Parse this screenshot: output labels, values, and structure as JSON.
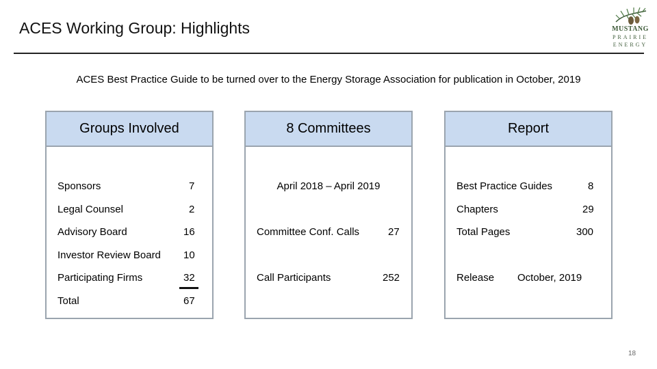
{
  "header": {
    "title": "ACES Working Group: Highlights",
    "logo": {
      "line1": "MUSTANG",
      "line2": "PRAIRIE",
      "line3": "ENERGY",
      "icon": "pinecone-branch-icon"
    }
  },
  "subtitle": "ACES Best Practice Guide to be turned over to the Energy Storage Association for publication in October, 2019",
  "panels": {
    "groups": {
      "heading": "Groups Involved",
      "rows": [
        {
          "label": "Sponsors",
          "value": "7"
        },
        {
          "label": "Legal Counsel",
          "value": "2"
        },
        {
          "label": "Advisory Board",
          "value": "16"
        },
        {
          "label": "Investor Review Board",
          "value": "10"
        },
        {
          "label": "Participating Firms",
          "value": "32"
        },
        {
          "label": "Total",
          "value": "67"
        }
      ]
    },
    "committees": {
      "heading": "8 Committees",
      "period": "April 2018 – April 2019",
      "rows": [
        {
          "label": "Committee Conf. Calls",
          "value": "27"
        },
        {
          "label": "Call Participants",
          "value": "252"
        }
      ]
    },
    "report": {
      "heading": "Report",
      "rows": [
        {
          "label": "Best Practice Guides",
          "value": "8"
        },
        {
          "label": "Chapters",
          "value": "29"
        },
        {
          "label": "Total Pages",
          "value": "300"
        },
        {
          "label": "Release",
          "value": "October, 2019"
        }
      ]
    }
  },
  "colors": {
    "panel_header": "#c9daf0",
    "panel_border": "#9aa4ae",
    "logo": "#3d5a38"
  },
  "footer": {
    "page_number": "18"
  }
}
